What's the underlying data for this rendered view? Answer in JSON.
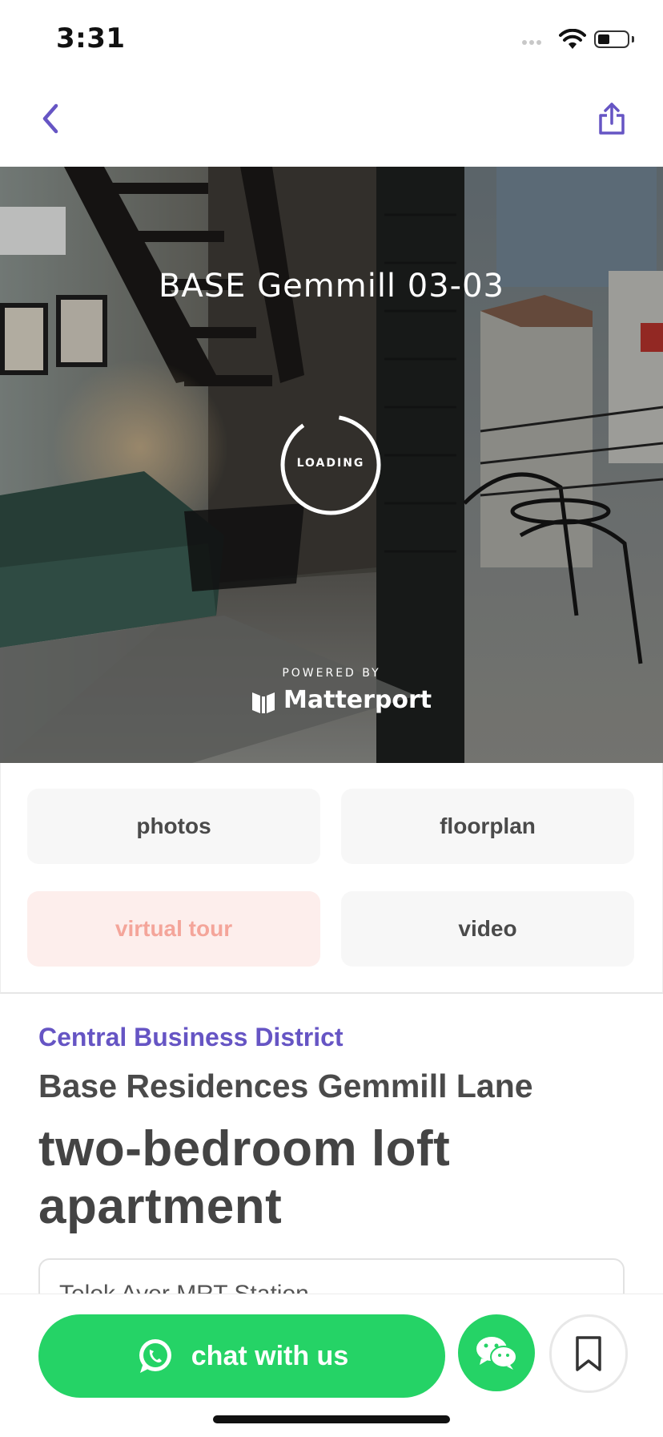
{
  "status_bar": {
    "time": "3:31"
  },
  "nav": {
    "back_icon": "chevron-left-icon",
    "share_icon": "share-icon",
    "accent_color": "#6655c4"
  },
  "hero": {
    "title": "BASE Gemmill 03-03",
    "loading_label": "LOADING",
    "powered_by": "POWERED BY",
    "brand": "Matterport"
  },
  "media_tabs": [
    {
      "label": "photos",
      "active": false
    },
    {
      "label": "floorplan",
      "active": false
    },
    {
      "label": "virtual tour",
      "active": true
    },
    {
      "label": "video",
      "active": false
    }
  ],
  "listing": {
    "district": "Central Business District",
    "building": "Base Residences Gemmill Lane",
    "unit_title": "two-bedroom loft apartment",
    "nearby_mrt": "Telok Ayer MRT Station"
  },
  "actions": {
    "chat_label": "chat with us",
    "chat_color": "#25d366",
    "wechat_icon": "wechat-icon",
    "bookmark_icon": "bookmark-icon"
  }
}
